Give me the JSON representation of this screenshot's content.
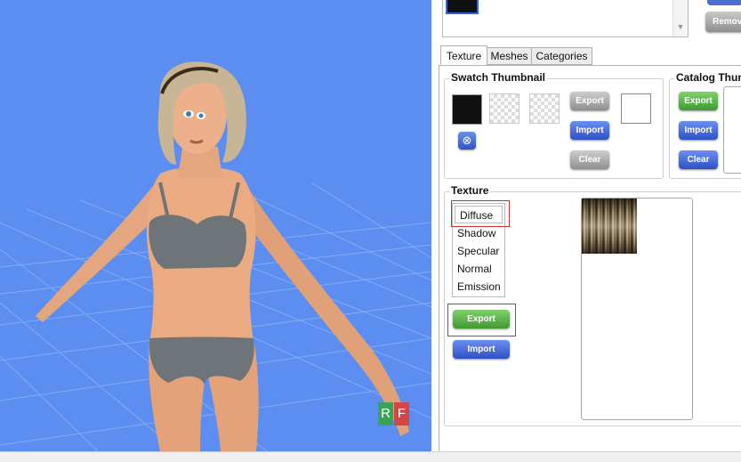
{
  "panel": {
    "remove_label": "Remov",
    "tabs": [
      "Texture",
      "Meshes",
      "Categories"
    ],
    "swatch_thumbnail": {
      "title": "Swatch Thumbnail",
      "export_label": "Export",
      "import_label": "Import",
      "clear_label": "Clear"
    },
    "catalog_thumbnail": {
      "title": "Catalog Thum",
      "export_label": "Export",
      "import_label": "Import",
      "clear_label": "Clear"
    },
    "texture": {
      "title": "Texture",
      "items": [
        "Diffuse",
        "Shadow",
        "Specular",
        "Normal",
        "Emission"
      ],
      "selected": "Diffuse",
      "export_label": "Export",
      "import_label": "Import"
    }
  },
  "viewport": {
    "cube_labels": [
      "R",
      "F"
    ]
  },
  "colors": {
    "viewport_bg": "#5b8ef0",
    "highlight": "#d03030"
  }
}
